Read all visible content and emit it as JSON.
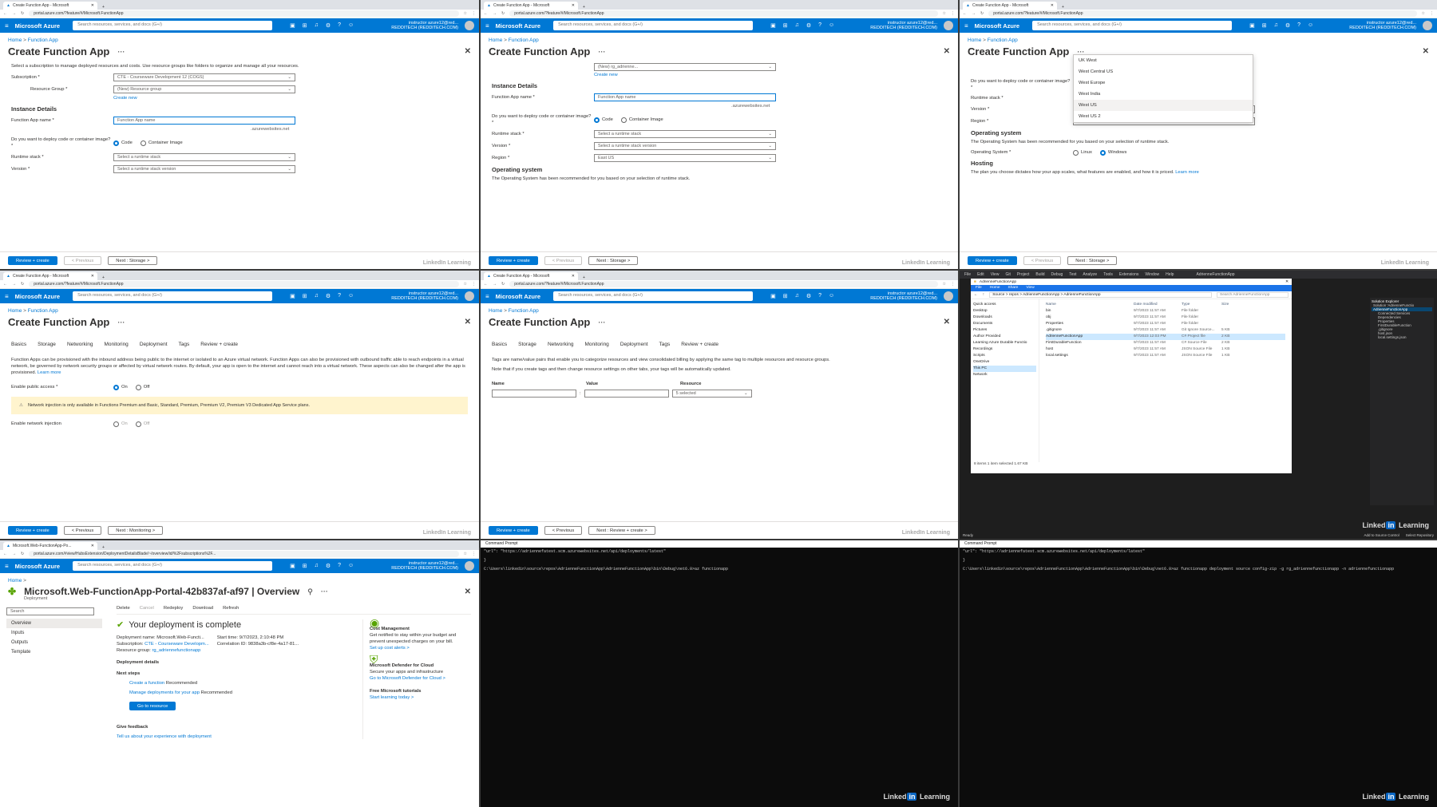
{
  "common": {
    "tab_title": "Create Function App - Microsoft",
    "url": "portal.azure.com/?feature/#/Microsoft.FunctionApp",
    "brand": "Microsoft Azure",
    "search_placeholder": "Search resources, services, and docs (G+/)",
    "user_line1": "instructor azure12@red...",
    "user_line2": "REDDITECH (REDDITECH.COM)",
    "crumb_home": "Home",
    "crumb_sep": ">",
    "crumb_fa": "Function App",
    "page_title": "Create Function App",
    "review": "Review + create",
    "previous": "< Previous",
    "next_storage": "Next : Storage >",
    "watermark": "LinkedIn Learning"
  },
  "p1": {
    "intro": "Select a subscription to manage deployed resources and costs. Use resource groups like folders to organize and manage all your resources.",
    "sub_label": "Subscription *",
    "sub_value": "CTE - Courseware Development 12 (COGS)",
    "rg_label": "Resource Group *",
    "rg_value": "(New) Resource group",
    "create_new": "Create new",
    "instance_h": "Instance Details",
    "name_label": "Function App name *",
    "name_ph": "Function App name",
    "suffix": ".azurewebsites.net",
    "deploy_label": "Do you want to deploy code or container image? *",
    "code": "Code",
    "container": "Container Image",
    "runtime_label": "Runtime stack *",
    "runtime_ph": "Select a runtime stack",
    "version_label": "Version *",
    "version_ph": "Select a runtime stack version"
  },
  "p2": {
    "rg_value": "(New) rg_adrienne...",
    "create_new": "Create new",
    "instance_h": "Instance Details",
    "name_label": "Function App name *",
    "name_ph": "Function App name",
    "suffix": ".azurewebsites.net",
    "deploy_label": "Do you want to deploy code or container image? *",
    "code": "Code",
    "container": "Container Image",
    "runtime_label": "Runtime stack *",
    "runtime_ph": "Select a runtime stack",
    "version_label": "Version *",
    "version_ph": "Select a runtime stack version",
    "region_label": "Region *",
    "region_value": "East US",
    "os_h": "Operating system",
    "os_text": "The Operating System has been recommended for you based on your selection of runtime stack."
  },
  "p3": {
    "regions": [
      "UK West",
      "West Central US",
      "West Europe",
      "West India",
      "West US",
      "West US 2"
    ],
    "deploy_label": "Do you want to deploy code or container image? *",
    "runtime_label": "Runtime stack *",
    "version_label": "Version *",
    "region_label": "Region *",
    "region_value": "East US",
    "os_h": "Operating system",
    "os_text": "The Operating System has been recommended for you based on your selection of runtime stack.",
    "os_label": "Operating System *",
    "linux": "Linux",
    "windows": "Windows",
    "hosting_h": "Hosting",
    "hosting_text": "The plan you choose dictates how your app scales, what features are enabled, and how it is priced.",
    "learn_more": "Learn more"
  },
  "p4": {
    "tabs": [
      "Basics",
      "Storage",
      "Networking",
      "Monitoring",
      "Deployment",
      "Tags",
      "Review + create"
    ],
    "desc": "Function Apps can be provisioned with the inbound address being public to the internet or isolated to an Azure virtual network. Function Apps can also be provisioned with outbound traffic able to reach endpoints in a virtual network, be governed by network security groups or affected by virtual network routes. By default, your app is open to the internet and cannot reach into a virtual network. These aspects can also be changed after the app is provisioned.",
    "learn_more": "Learn more",
    "public_label": "Enable public access *",
    "on": "On",
    "off": "Off",
    "warning": "Network injection is only available in Functions Premium and Basic, Standard, Premium, Premium V2, Premium V3 Dedicated App Service plans.",
    "inj_label": "Enable network injection",
    "next": "Next : Monitoring >"
  },
  "p5": {
    "tabs": [
      "Basics",
      "Storage",
      "Networking",
      "Monitoring",
      "Deployment",
      "Tags",
      "Review + create"
    ],
    "desc1": "Tags are name/value pairs that enable you to categorize resources and view consolidated billing by applying the same tag to multiple resources and resource groups.",
    "desc2": "Note that if you create tags and then change resource settings on other tabs, your tags will be automatically updated.",
    "name_h": "Name",
    "value_h": "Value",
    "resource_h": "Resource",
    "resource_value": "5 selected",
    "colon": ":",
    "next": "Next : Review + create >"
  },
  "p6": {
    "menu": [
      "File",
      "Edit",
      "View",
      "Git",
      "Project",
      "Build",
      "Debug",
      "Test",
      "Analyze",
      "Tools",
      "Extensions",
      "Window",
      "Help"
    ],
    "app_title": "AdrienneFunctionApp",
    "explorer_title": "AdrienneFunctionApp",
    "explorer_path": "Source > repos > AdrienneFunctionApp > AdrienneFunctionApp",
    "explorer_search": "Search AdrienneFunctionApp",
    "ribbon_tabs": [
      "File",
      "Home",
      "Share",
      "View"
    ],
    "nav": [
      "Quick access",
      "Desktop",
      "Downloads",
      "Documents",
      "Pictures",
      "Author Provided",
      "Learning Azure Durable Functio",
      "Recordings",
      "Scripts",
      "OneDrive",
      "This PC",
      "Network"
    ],
    "col_name": "Name",
    "col_date": "Date modified",
    "col_type": "Type",
    "col_size": "Size",
    "files": [
      {
        "n": "bin",
        "d": "9/7/2023 11:57 AM",
        "t": "File folder",
        "s": ""
      },
      {
        "n": "obj",
        "d": "9/7/2023 11:57 AM",
        "t": "File folder",
        "s": ""
      },
      {
        "n": "Properties",
        "d": "9/7/2023 11:57 AM",
        "t": "File folder",
        "s": ""
      },
      {
        "n": ".gitignore",
        "d": "9/7/2023 11:57 AM",
        "t": "Git Ignore Source...",
        "s": "5 KB"
      },
      {
        "n": "AdrienneFunctionApp",
        "d": "9/7/2023 12:03 PM",
        "t": "C# Project file",
        "s": "2 KB"
      },
      {
        "n": "FirstDurableFunction",
        "d": "9/7/2023 11:57 AM",
        "t": "C# Source File",
        "s": "2 KB"
      },
      {
        "n": "host",
        "d": "9/7/2023 11:57 AM",
        "t": "JSON Source File",
        "s": "1 KB"
      },
      {
        "n": "local.settings",
        "d": "9/7/2023 11:57 AM",
        "t": "JSON Source File",
        "s": "1 KB"
      }
    ],
    "status": "8 items    1 item selected  1.67 KB",
    "solution_title": "Solution Explorer",
    "solution_items": [
      "Solution 'AdrienneFunctio",
      "AdrienneFunctionApp",
      "Connected Services",
      "Dependencies",
      "Properties",
      "FirstDurableFunction",
      ".gitignore",
      "host.json",
      "local.settings.json"
    ],
    "ready": "Ready",
    "add_source": "Add to Source Control",
    "select_repo": "Select Repository"
  },
  "p7": {
    "tab_title": "Microsoft.Web-FunctionApp-Po...",
    "url": "portal.azure.com/#view/HubsExtension/DeploymentDetailsBlade/~/overview/id/%2Fsubscriptions%2F...",
    "title": "Microsoft.Web-FunctionApp-Portal-42b837af-af97 | Overview",
    "subtitle": "Deployment",
    "search": "Search",
    "nav": [
      "Overview",
      "Inputs",
      "Outputs",
      "Template"
    ],
    "toolbar": [
      "Delete",
      "Cancel",
      "Redeploy",
      "Download",
      "Refresh"
    ],
    "complete": "Your deployment is complete",
    "dep_name_l": "Deployment name:",
    "dep_name_v": "Microsoft.Web-Functi...",
    "sub_l": "Subscription:",
    "sub_v": "CTE - Courseware Developm...",
    "rg_l": "Resource group:",
    "rg_v": "rg_adriennefunctionapp",
    "start_l": "Start time:",
    "start_v": "9/7/2023, 2:10:48 PM",
    "corr_l": "Correlation ID:",
    "corr_v": "9838a3b-cf8e-4a17-81...",
    "details": "Deployment details",
    "next_steps": "Next steps",
    "step1": "Create a function",
    "step2": "Manage deployments for your app",
    "recommended": "Recommended",
    "go": "Go to resource",
    "feedback_h": "Give feedback",
    "feedback": "Tell us about your experience with deployment",
    "cost_h": "Cost Management",
    "cost_t": "Get notified to stay within your budget and prevent unexpected charges on your bill.",
    "cost_l": "Set up cost alerts >",
    "def_h": "Microsoft Defender for Cloud",
    "def_t": "Secure your apps and infrastructure",
    "def_l": "Go to Microsoft Defender for Cloud >",
    "tut_h": "Free Microsoft tutorials",
    "tut_l": "Start learning today >"
  },
  "p8": {
    "title": "Command Prompt",
    "line1": "\"url\": \"https://adriennefatest.scm.azurewebsites.net/api/deployments/latest\"",
    "line2": "}",
    "line3": "C:\\Users\\linkedin\\source\\repos\\AdrienneFunctionApp\\AdrienneFunctionApp\\bin\\Debug\\net6.0>az functionapp"
  },
  "p9": {
    "title": "Command Prompt",
    "line1": "\"url\": \"https://adriennefatest.scm.azurewebsites.net/api/deployments/latest\"",
    "line2": "}",
    "line3": "C:\\Users\\linkedin\\source\\repos\\AdrienneFunctionApp\\AdrienneFunctionApp\\bin\\Debug\\net6.0>az functionapp deployment source config-zip -g rg_adriennefunctionapp -n adriennefunctionapp"
  },
  "colors": {
    "azure_blue": "#0078d4",
    "terminal_bg": "#0c0c0c",
    "vs_bg": "#1e1e1e"
  }
}
